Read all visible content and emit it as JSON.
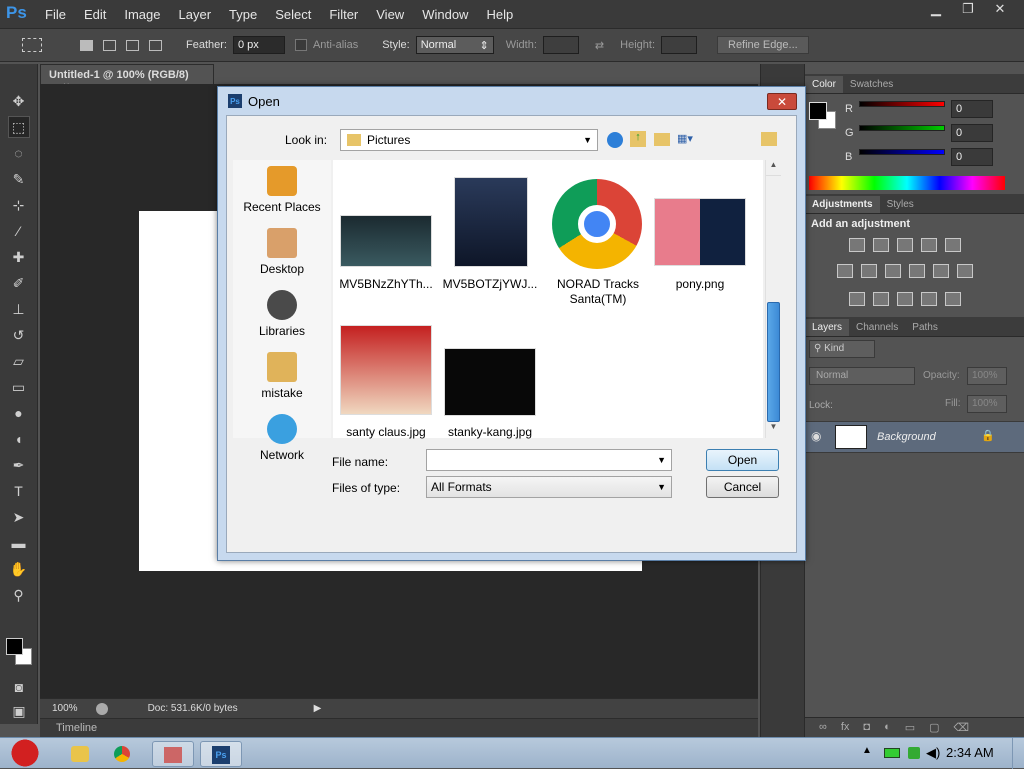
{
  "app": {
    "logo": "Ps",
    "menu": [
      "File",
      "Edit",
      "Image",
      "Layer",
      "Type",
      "Select",
      "Filter",
      "View",
      "Window",
      "Help"
    ]
  },
  "options": {
    "feather_label": "Feather:",
    "feather_value": "0 px",
    "antialias_label": "Anti-alias",
    "style_label": "Style:",
    "style_value": "Normal",
    "width_label": "Width:",
    "height_label": "Height:",
    "refine_label": "Refine Edge..."
  },
  "document": {
    "tab_title": "Untitled-1 @ 100% (RGB/8)",
    "tab_close": "×",
    "zoom": "100%",
    "doc_info": "Doc: 531.6K/0 bytes",
    "timeline": "Timeline"
  },
  "color_panel": {
    "tabs": [
      "Color",
      "Swatches"
    ],
    "r_label": "R",
    "g_label": "G",
    "b_label": "B",
    "r_value": "0",
    "g_value": "0",
    "b_value": "0"
  },
  "adjust_panel": {
    "tabs": [
      "Adjustments",
      "Styles"
    ],
    "heading": "Add an adjustment"
  },
  "layers_panel": {
    "tabs": [
      "Layers",
      "Channels",
      "Paths"
    ],
    "kind_label": "Kind",
    "blend_mode": "Normal",
    "opacity_label": "Opacity:",
    "opacity_value": "100%",
    "lock_label": "Lock:",
    "fill_label": "Fill:",
    "fill_value": "100%",
    "layer_name": "Background"
  },
  "dialog": {
    "title": "Open",
    "close": "✕",
    "look_in_label": "Look in:",
    "look_in_value": "Pictures",
    "places": [
      "Recent Places",
      "Desktop",
      "Libraries",
      "mistake",
      "Network"
    ],
    "files": [
      {
        "name": "MV5BNzZhYTh..."
      },
      {
        "name": "MV5BOTZjYWJ..."
      },
      {
        "name": "NORAD Tracks Santa(TM)"
      },
      {
        "name": "pony.png"
      },
      {
        "name": "santy claus.jpg"
      },
      {
        "name": "stanky-kang.jpg"
      }
    ],
    "filename_label": "File name:",
    "filename_value": "",
    "filetype_label": "Files of type:",
    "filetype_value": "All Formats",
    "open_button": "Open",
    "cancel_button": "Cancel"
  },
  "taskbar": {
    "time": "2:34 AM"
  },
  "colors": {
    "ps_blue": "#3d95e8",
    "dialog_frame": "#c7d9ee",
    "close_red": "#c94a3b"
  }
}
